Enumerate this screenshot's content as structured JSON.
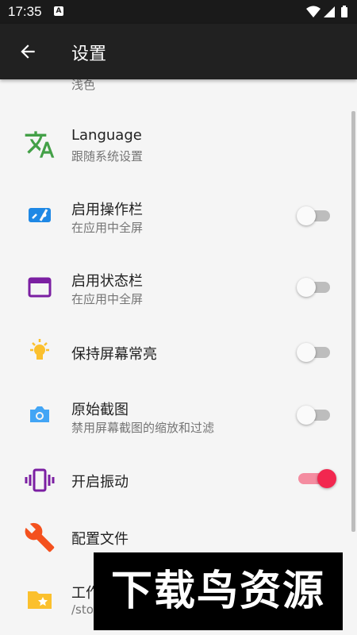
{
  "status_bar": {
    "time": "17:35",
    "notification_icon": "A"
  },
  "app_bar": {
    "back_icon": "arrow-left-icon",
    "title": "设置"
  },
  "settings": [
    {
      "id": "theme",
      "icon": "palette-icon",
      "sub": "浅色"
    },
    {
      "id": "language",
      "icon": "translate-icon",
      "label": "Language",
      "sub": "跟随系统设置"
    },
    {
      "id": "action-bar",
      "icon": "action-bar-icon",
      "label": "启用操作栏",
      "sub": "在应用中全屏",
      "toggle": false
    },
    {
      "id": "status-bar",
      "icon": "window-icon",
      "label": "启用状态栏",
      "sub": "在应用中全屏",
      "toggle": false
    },
    {
      "id": "keep-screen-on",
      "icon": "lightbulb-icon",
      "label": "保持屏幕常亮",
      "toggle": false
    },
    {
      "id": "raw-screenshot",
      "icon": "camera-icon",
      "label": "原始截图",
      "sub": "禁用屏幕截图的缩放和过滤",
      "toggle": false
    },
    {
      "id": "vibration",
      "icon": "vibrate-icon",
      "label": "开启振动",
      "toggle": true
    },
    {
      "id": "config-file",
      "icon": "wrench-icon",
      "label": "配置文件"
    },
    {
      "id": "workdir",
      "icon": "folder-star-icon",
      "label": "工作",
      "sub": "/sto"
    }
  ],
  "watermark": "下载鸟资源",
  "colors": {
    "toggle_on": "#f2274f",
    "language_icon": "#43a047",
    "action_icon": "#1e88e5",
    "window_icon": "#7b1fa2",
    "bulb_icon": "#fbc02d",
    "camera_icon": "#42a5f5",
    "vibrate_icon": "#7b1fa2",
    "wrench_icon": "#f4511e",
    "folder_icon": "#fbc02d"
  }
}
